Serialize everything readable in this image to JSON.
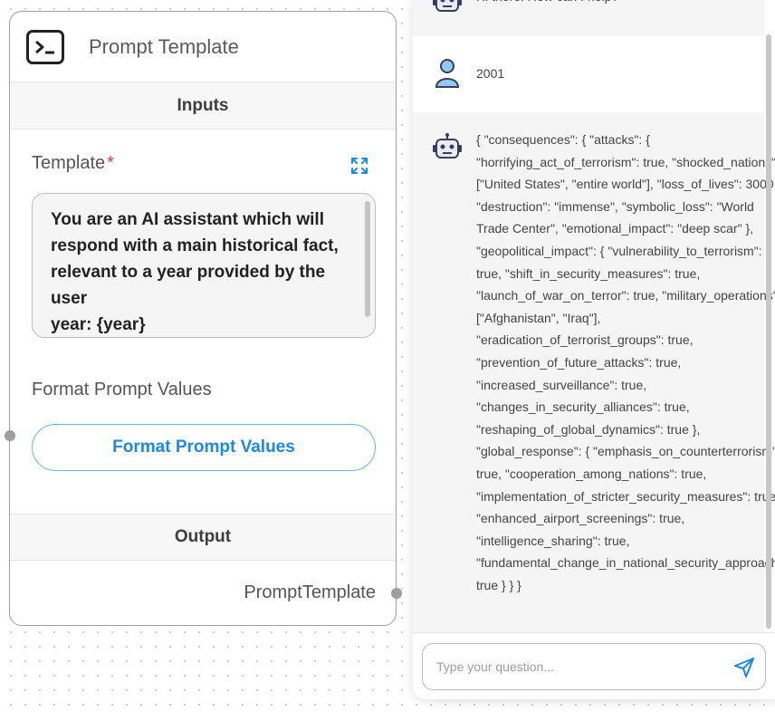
{
  "node": {
    "title": "Prompt Template",
    "inputs_label": "Inputs",
    "template_label": "Template",
    "required_mark": "*",
    "template_value": "You are an AI assistant which will\nrespond with a main historical fact,\nrelevant to a year provided by the\nuser\nyear: {year}",
    "format_label": "Format Prompt Values",
    "format_button": "Format Prompt Values",
    "output_label": "Output",
    "output_name": "PromptTemplate"
  },
  "chat": {
    "messages": [
      {
        "role": "bot",
        "text": "Hi there! How can I help?"
      },
      {
        "role": "user",
        "text": "2001"
      },
      {
        "role": "bot",
        "text": "{ \"consequences\": { \"attacks\": {\n\"horrifying_act_of_terrorism\": true, \"shocked_nations\":\n[\"United States\", \"entire world\"], \"loss_of_lives\": 3000,\n\"destruction\": \"immense\", \"symbolic_loss\": \"World\nTrade Center\", \"emotional_impact\": \"deep scar\" },\n\"geopolitical_impact\": { \"vulnerability_to_terrorism\":\ntrue, \"shift_in_security_measures\": true,\n\"launch_of_war_on_terror\": true, \"military_operations\":\n[\"Afghanistan\", \"Iraq\"],\n\"eradication_of_terrorist_groups\": true,\n\"prevention_of_future_attacks\": true,\n\"increased_surveillance\": true,\n\"changes_in_security_alliances\": true,\n\"reshaping_of_global_dynamics\": true },\n\"global_response\": { \"emphasis_on_counterterrorism\":\ntrue, \"cooperation_among_nations\": true,\n\"implementation_of_stricter_security_measures\": true,\n\"enhanced_airport_screenings\": true,\n\"intelligence_sharing\": true,\n\"fundamental_change_in_national_security_approach\":\ntrue } } }"
      }
    ],
    "input_placeholder": "Type your question..."
  },
  "colors": {
    "accent": "#1e88e5",
    "required": "#e53935",
    "bot_icon": "#3f3d56",
    "user_icon": "#90caf9"
  },
  "icons": {
    "node": "terminal-icon",
    "expand": "expand-icon",
    "bot": "robot-icon",
    "user": "user-icon",
    "send": "send-icon"
  }
}
